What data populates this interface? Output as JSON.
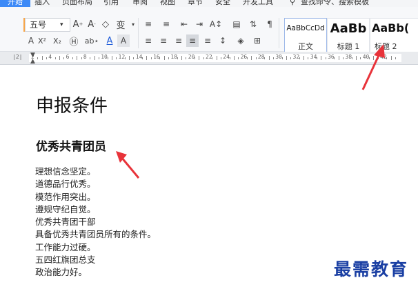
{
  "menubar": {
    "start_tab": "开始",
    "items": [
      "插入",
      "页面布局",
      "引用",
      "审阅",
      "视图",
      "章节",
      "安全",
      "开发工具"
    ],
    "search_text": "查找命令、搜索模板"
  },
  "font": {
    "size_value": "五号"
  },
  "style_gallery": [
    {
      "sample": "AaBbCcDd",
      "label": "正文"
    },
    {
      "sample": "AaBb",
      "label": "标题 1"
    },
    {
      "sample": "AaBb(",
      "label": "标题 2"
    }
  ],
  "ruler": {
    "numbers": [
      "2",
      "4",
      "6",
      "8",
      "10",
      "12",
      "14",
      "16",
      "18",
      "20",
      "22",
      "24",
      "26",
      "28",
      "30",
      "32",
      "34",
      "36",
      "38",
      "40",
      "42"
    ]
  },
  "document": {
    "title": "申报条件",
    "subtitle": "优秀共青团员",
    "lines": [
      "理想信念坚定。",
      "道德品行优秀。",
      "模范作用突出。",
      "遵规守纪自觉。",
      "优秀共青团干部",
      "具备优秀共青团员所有的条件。",
      "工作能力过硬。",
      "五四红旗团总支",
      "政治能力好。"
    ]
  },
  "watermark": "最需教育",
  "colors": {
    "accent": "#3d8af7",
    "arrow": "#e8333a",
    "watermark": "#1a3fa3"
  }
}
